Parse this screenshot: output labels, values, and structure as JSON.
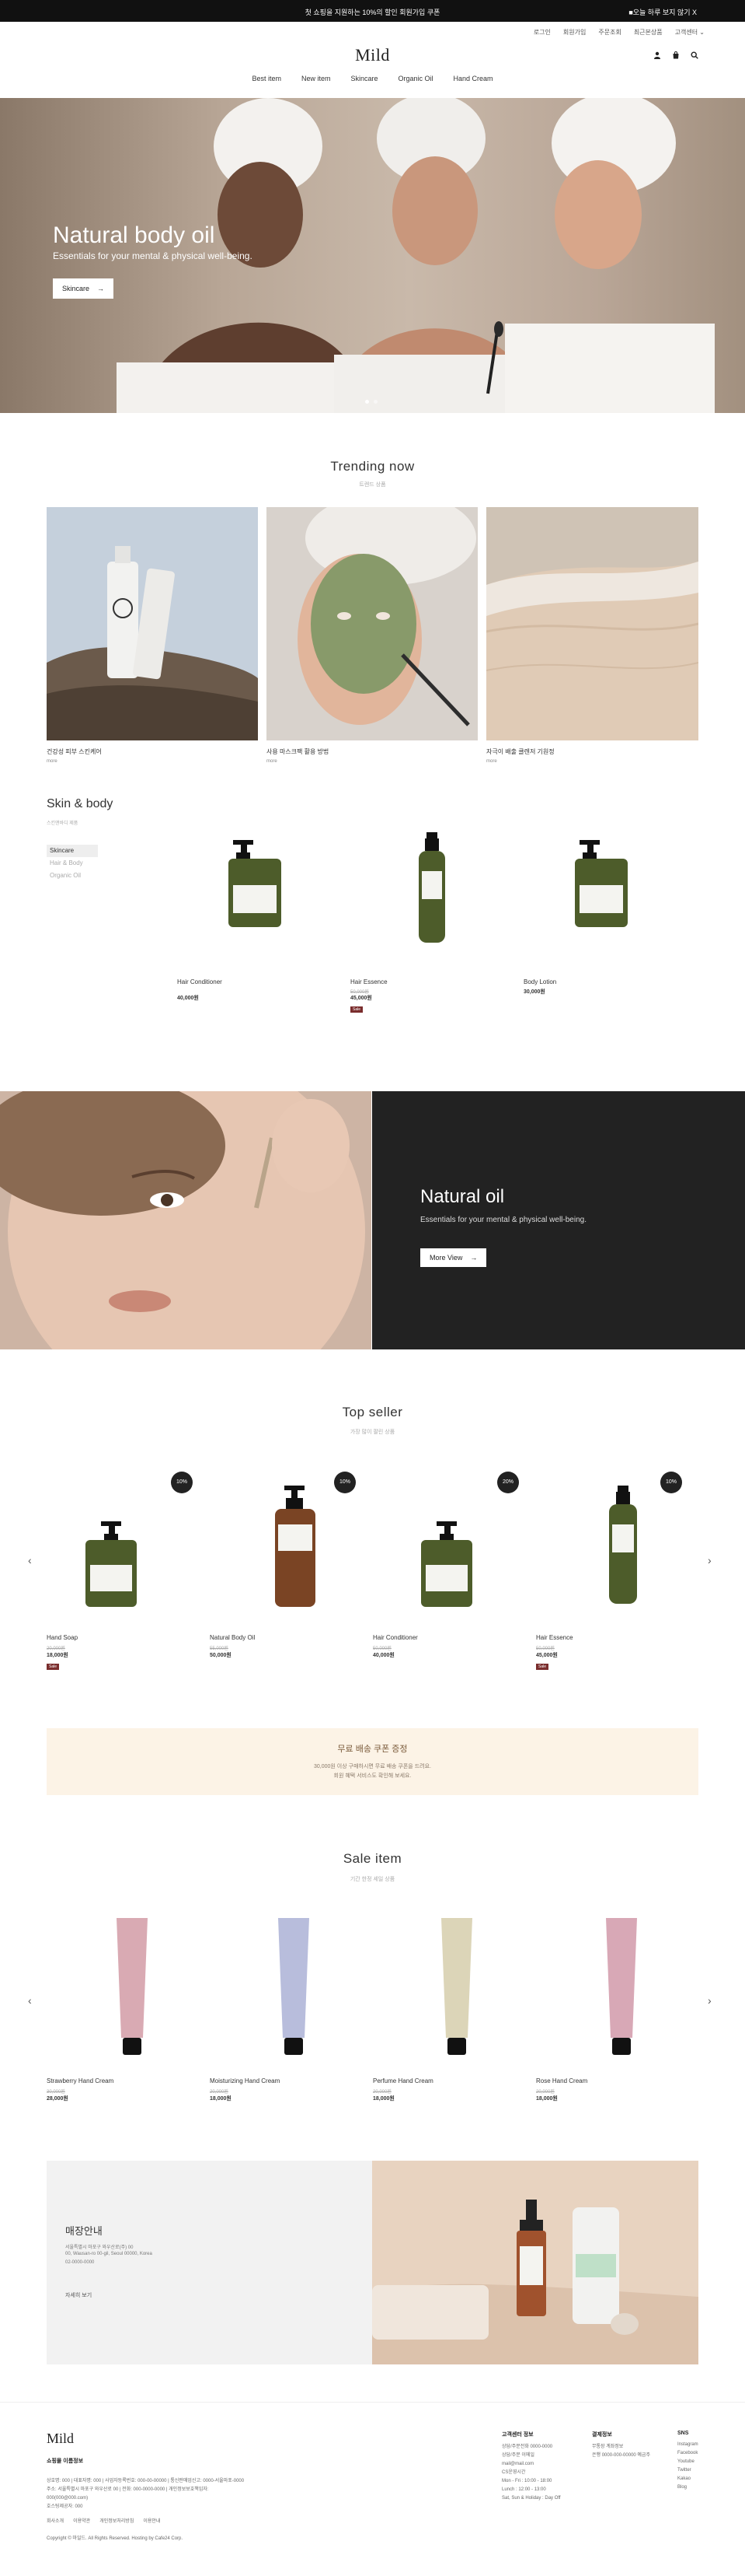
{
  "topbar": {
    "announcement": "첫 쇼핑을 지원하는 10%의 할인 회원가입 쿠폰",
    "right_link": "■오늘 하루 보지 않기 X"
  },
  "util_links": [
    "로그인",
    "회원가입",
    "주문조회",
    "최근본상품",
    "고객센터 ⌄"
  ],
  "logo": "Mild",
  "nav": [
    "Best item",
    "New item",
    "Skincare",
    "Organic Oil",
    "Hand Cream"
  ],
  "hero": {
    "title": "Natural body oil",
    "subtitle": "Essentials for your mental & physical well-being.",
    "button": "Skincare",
    "slide_count": 2,
    "active_slide": 1
  },
  "trending": {
    "title": "Trending now",
    "subtitle": "트렌드 상품",
    "items": [
      {
        "caption": "건강성 피부 스킨케어",
        "more": "more"
      },
      {
        "caption": "사용 마스크팩 활용 방법",
        "more": "more"
      },
      {
        "caption": "자극이 배출 클렌저 기원정",
        "more": "more"
      }
    ]
  },
  "skin_body": {
    "title": "Skin & body",
    "subtitle": "스킨앤바디 제품",
    "tabs": [
      "Skincare",
      "Hair & Body",
      "Organic Oil"
    ],
    "active_tab": 0,
    "products": [
      {
        "name": "Hair Conditioner",
        "old_price": "",
        "price": "40,000원",
        "badge": ""
      },
      {
        "name": "Hair Essence",
        "old_price": "50,000원",
        "price": "45,000원",
        "badge": "Sale"
      },
      {
        "name": "Body Lotion",
        "old_price": "",
        "price": "30,000원",
        "badge": ""
      }
    ]
  },
  "banner": {
    "title": "Natural oil",
    "subtitle": "Essentials for your mental & physical well-being.",
    "button": "More View"
  },
  "top_seller": {
    "title": "Top seller",
    "subtitle": "가장 많이 팔린 상품",
    "products": [
      {
        "name": "Hand Soap",
        "old_price": "20,000원",
        "price": "18,000원",
        "badge": "Sale",
        "discount": "10%"
      },
      {
        "name": "Natural Body Oil",
        "old_price": "55,000원",
        "price": "50,000원",
        "badge": "",
        "discount": "10%"
      },
      {
        "name": "Hair Conditioner",
        "old_price": "50,000원",
        "price": "40,000원",
        "badge": "",
        "discount": "20%"
      },
      {
        "name": "Hair Essence",
        "old_price": "50,000원",
        "price": "45,000원",
        "badge": "Sale",
        "discount": "10%"
      }
    ]
  },
  "coupon": {
    "title": "무료 배송 쿠폰 증정",
    "line1": "30,000원 이상 구매하시면 무료 배송 쿠폰을 드려요.",
    "line2": "회원 혜택 서비스도 확인해 보세요."
  },
  "sale_item": {
    "title": "Sale item",
    "subtitle": "기간 한정 세일 상품",
    "products": [
      {
        "name": "Strawberry Hand Cream",
        "old_price": "30,000원",
        "price": "28,000원",
        "color": "#d9aab3"
      },
      {
        "name": "Moisturizing Hand Cream",
        "old_price": "20,000원",
        "price": "18,000원",
        "color": "#b8bddc"
      },
      {
        "name": "Perfume Hand Cream",
        "old_price": "20,000원",
        "price": "18,000원",
        "color": "#dcd5b8"
      },
      {
        "name": "Rose Hand Cream",
        "old_price": "20,000원",
        "price": "18,000원",
        "color": "#d8a8b6"
      }
    ]
  },
  "store": {
    "title": "매장안내",
    "address": "서울특별시 마포구 와우산로(주) 00",
    "address2": "00, Wausan-ro 00-gil, Seoul 00000, Korea",
    "phone": "02-0000-0000",
    "link": "자세히 보기"
  },
  "footer": {
    "logo": "Mild",
    "company": "쇼핑몰 이름정보",
    "info_lines": [
      "상호명: 000 | 대표자명: 000 | 사업자등록번호: 000-00-00000 | 통신판매업신고: 0000-서울마포-0000",
      "주소: 서울특별시 마포구 와우산로 00 | 전화: 000-0000-0000 | 개인정보보호책임자: 000(000@000.com)",
      "호스팅제공자: 000"
    ],
    "policy_links": [
      "회사소개",
      "이용약관",
      "개인정보처리방침",
      "이용안내"
    ],
    "copyright": "Copyright © 마일드. All Rights Reserved. Hosting by Cafe24 Corp.",
    "cs_title": "고객센터 정보",
    "cs_lines": [
      "상담/주문전화 0000-0000",
      "상담/주문 이메일",
      "mail@mail.com",
      "CS운영시간",
      "Mon - Fri : 10:00 - 18:00",
      "Lunch : 12:00 - 13:00",
      "Sat, Sun & Holiday : Day Off"
    ],
    "bank_title": "결제정보",
    "bank_lines": [
      "무통장 계좌정보",
      "은행 0000-000-00000 예금주"
    ],
    "sns_title": "SNS",
    "sns_links": [
      "Instagram",
      "Facebook",
      "Youtube",
      "Twitter",
      "Kakao",
      "Blog"
    ]
  },
  "colors": {
    "topbar": "#111111",
    "banner_dark": "#222222",
    "sale_badge": "#7a2d2d",
    "coupon_bg": "#fcf3e6",
    "store_bg": "#f2f2f2"
  }
}
